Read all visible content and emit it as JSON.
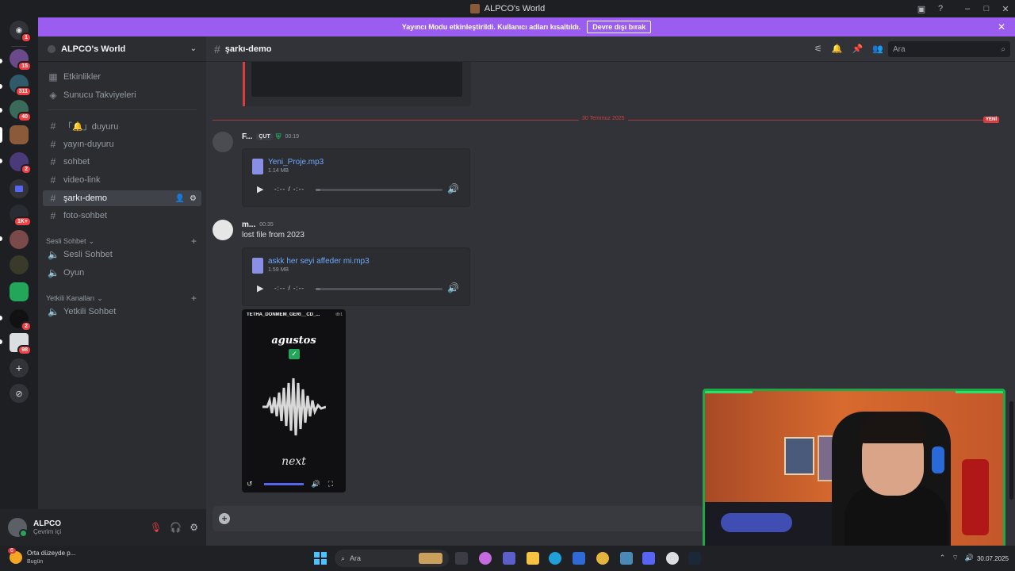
{
  "window": {
    "title": "ALPCO's World"
  },
  "banner": {
    "message": "Yayıncı Modu etkinleştirildi. Kullanıcı adları kısaltıldı.",
    "button": "Devre dışı bırak",
    "color": "#9b5cf0"
  },
  "rail": {
    "home_badge": "1",
    "servers": [
      {
        "badge": "15"
      },
      {
        "badge": "311"
      },
      {
        "badge": "40"
      },
      {
        "badge": ""
      },
      {
        "badge": "2"
      },
      {
        "badge": ""
      },
      {
        "badge": "1K+"
      },
      {
        "badge": ""
      },
      {
        "badge": ""
      },
      {
        "badge": ""
      },
      {
        "badge": "2"
      },
      {
        "badge": "98"
      }
    ]
  },
  "sidebar": {
    "server_name": "ALPCO's World",
    "top_items": [
      {
        "label": "Etkinlikler",
        "icon": "calendar-icon"
      },
      {
        "label": "Sunucu Takviyeleri",
        "icon": "boost-icon"
      }
    ],
    "text_channels": [
      {
        "label": "「🔔」duyuru"
      },
      {
        "label": "yayın-duyuru"
      },
      {
        "label": "sohbet"
      },
      {
        "label": "video-link"
      },
      {
        "label": "şarkı-demo",
        "active": true
      },
      {
        "label": "foto-sohbet"
      }
    ],
    "voice_category": "Sesli Sohbet",
    "voice_channels": [
      {
        "label": "Sesli Sohbet"
      },
      {
        "label": "Oyun"
      }
    ],
    "staff_category": "Yetkili Kanalları",
    "staff_channels": [
      {
        "label": "Yetkili Sohbet"
      }
    ]
  },
  "user": {
    "name": "ALPCO",
    "status": "Çevrim içi"
  },
  "channel": {
    "name": "şarkı-demo",
    "search_placeholder": "Ara"
  },
  "divider": {
    "date": "30 Temmuz 2025",
    "new_label": "YENİ"
  },
  "messages": [
    {
      "author": "F...",
      "tag": "ÇUT",
      "time": "00:19",
      "attachment": {
        "name": "Yeni_Proje.mp3",
        "size": "1.14 MB",
        "time": "-:-- / -:--",
        "progress": 0.04
      }
    },
    {
      "author": "m...",
      "time": "00:35",
      "text": "lost file from 2023",
      "attachment": {
        "name": "askk her seyi affeder mi.mp3",
        "size": "1.59 MB",
        "time": "-:-- / -:--",
        "progress": 0.04
      },
      "video": {
        "title": "TETHA_DONMEM_GERI__CD_...",
        "brand": "t8r1",
        "headline": "agustos",
        "footer": "next"
      }
    }
  ],
  "taskbar": {
    "weather_badge": "6",
    "weather_text": "Orta düzeyde p...",
    "weather_sub": "Bugün",
    "search": "Ara",
    "date": "30.07.2025"
  }
}
